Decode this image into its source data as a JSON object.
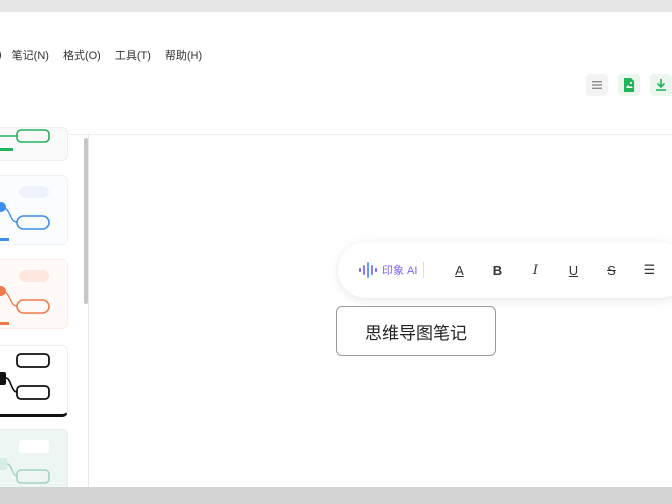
{
  "menu": {
    "items": [
      {
        "id": "partial",
        "label": ")"
      },
      {
        "id": "notes",
        "label": "笔记(N)"
      },
      {
        "id": "format",
        "label": "格式(O)"
      },
      {
        "id": "tools",
        "label": "工具(T)"
      },
      {
        "id": "help",
        "label": "帮助(H)"
      }
    ]
  },
  "toolbar": {
    "icons": [
      "list-icon",
      "export-image-icon",
      "download-icon"
    ]
  },
  "sidebar": {
    "themes": [
      {
        "name": "theme-green",
        "accent": "#22b45b"
      },
      {
        "name": "theme-blue",
        "accent": "#3b8ef0"
      },
      {
        "name": "theme-orange",
        "accent": "#f07a4a"
      },
      {
        "name": "theme-black",
        "accent": "#111111"
      },
      {
        "name": "theme-mint",
        "accent": "#9fd2c6"
      }
    ]
  },
  "format_bar": {
    "ai_label": "印象 AI",
    "buttons": [
      {
        "id": "font-color",
        "label": "A"
      },
      {
        "id": "bold",
        "label": "B"
      },
      {
        "id": "italic",
        "label": "I"
      },
      {
        "id": "underline",
        "label": "U"
      },
      {
        "id": "strikethrough",
        "label": "S"
      },
      {
        "id": "align",
        "label": "☰"
      }
    ]
  },
  "canvas": {
    "node_text": "思维导图笔记"
  },
  "colors": {
    "accent_green": "#22b45b",
    "ai_purple": "#7b61ff"
  }
}
